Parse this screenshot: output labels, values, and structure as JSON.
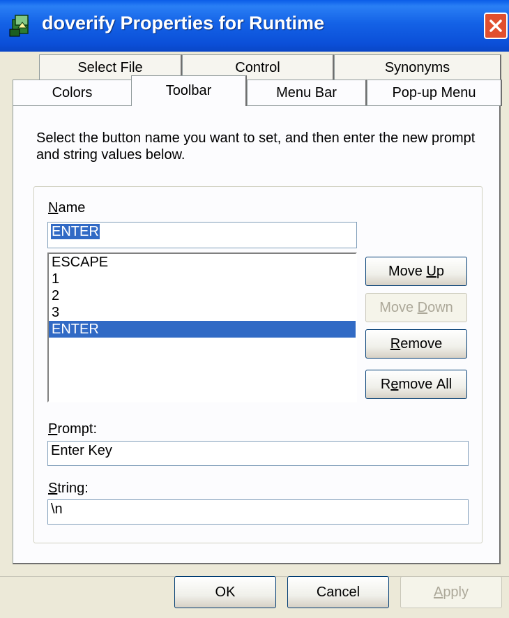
{
  "window": {
    "title": "doverify Properties for Runtime",
    "close_label": "×"
  },
  "tabs": {
    "row1": [
      "Select File",
      "Control",
      "Synonyms"
    ],
    "row2": [
      "Colors",
      "Toolbar",
      "Menu Bar",
      "Pop-up Menu"
    ],
    "active": "Toolbar"
  },
  "content": {
    "instructions": "Select the button name you want to set, and then enter the new prompt and string values below.",
    "name_label": "Name",
    "name_value": "ENTER",
    "list_items": [
      "ESCAPE",
      "1",
      "2",
      "3",
      "ENTER"
    ],
    "selected_item": "ENTER",
    "buttons": {
      "move_up": "Move Up",
      "move_down": "Move Down",
      "remove": "Remove",
      "remove_all": "Remove All"
    },
    "prompt_label": "Prompt:",
    "prompt_value": "Enter Key",
    "string_label": "String:",
    "string_value": "\\n"
  },
  "footer": {
    "ok": "OK",
    "cancel": "Cancel",
    "apply": "Apply"
  },
  "colors": {
    "titlebar": "#0b4fd8",
    "selection": "#316ac5",
    "close": "#e14f2e"
  }
}
